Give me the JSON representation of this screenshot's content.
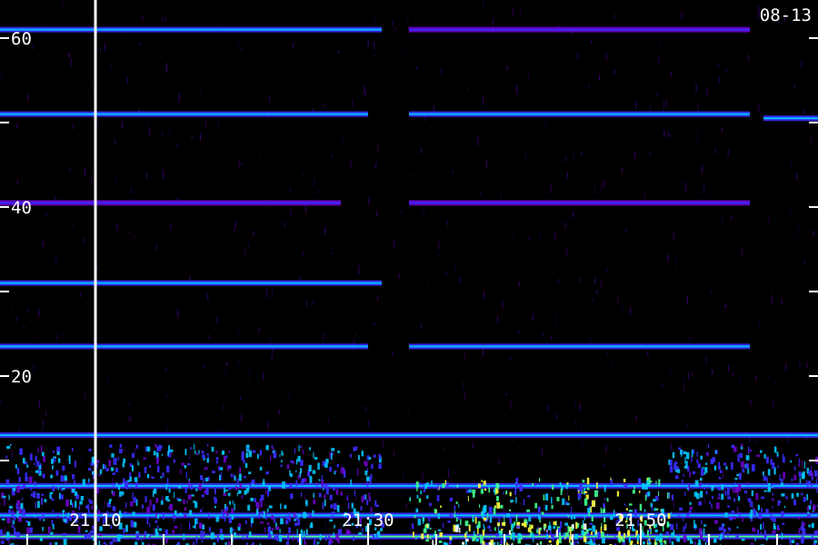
{
  "chart_data": {
    "type": "heatmap",
    "title": "",
    "date_label": "08-13",
    "xlabel": "",
    "ylabel": "",
    "ylim": [
      0,
      64.5
    ],
    "y_ticks": [
      {
        "value": 60,
        "label": "60"
      },
      {
        "value": 50,
        "label": ""
      },
      {
        "value": 40,
        "label": "40"
      },
      {
        "value": 30,
        "label": ""
      },
      {
        "value": 20,
        "label": "20"
      },
      {
        "value": 10,
        "label": ""
      }
    ],
    "x_range": [
      "21:03",
      "21:63"
    ],
    "x_ticks": [
      {
        "value": "21:10",
        "label": "21:10"
      },
      {
        "value": "21:30",
        "label": "21:30"
      },
      {
        "value": "21:50",
        "label": "21:50"
      }
    ],
    "grid": false,
    "colormap": [
      "#000000",
      "#6a00c8",
      "#3a2cff",
      "#00c8ff",
      "#40ff90",
      "#ffff40",
      "#ffffff"
    ],
    "marker_time": "21:10",
    "features": [
      {
        "kind": "carrier",
        "freq": 61,
        "t_start": "21:03",
        "t_end": "21:31",
        "level": 0.45
      },
      {
        "kind": "carrier",
        "freq": 61,
        "t_start": "21:33",
        "t_end": "21:58",
        "level": 0.35
      },
      {
        "kind": "carrier",
        "freq": 51,
        "t_start": "21:03",
        "t_end": "21:30",
        "level": 0.45
      },
      {
        "kind": "carrier",
        "freq": 51,
        "t_start": "21:33",
        "t_end": "21:58",
        "level": 0.45
      },
      {
        "kind": "carrier",
        "freq": 50.5,
        "t_start": "21:59",
        "t_end": "21:63",
        "level": 0.55
      },
      {
        "kind": "carrier",
        "freq": 40.5,
        "t_start": "21:03",
        "t_end": "21:28",
        "level": 0.3
      },
      {
        "kind": "carrier",
        "freq": 40.5,
        "t_start": "21:33",
        "t_end": "21:58",
        "level": 0.4
      },
      {
        "kind": "carrier",
        "freq": 31,
        "t_start": "21:03",
        "t_end": "21:31",
        "level": 0.5
      },
      {
        "kind": "carrier",
        "freq": 23.5,
        "t_start": "21:03",
        "t_end": "21:30",
        "level": 0.45
      },
      {
        "kind": "carrier",
        "freq": 23.5,
        "t_start": "21:33",
        "t_end": "21:58",
        "level": 0.55
      },
      {
        "kind": "carrier",
        "freq": 13,
        "t_start": "21:03",
        "t_end": "21:63",
        "level": 0.45
      },
      {
        "kind": "carrier",
        "freq": 7,
        "t_start": "21:03",
        "t_end": "21:63",
        "level": 0.5
      },
      {
        "kind": "carrier",
        "freq": 3.5,
        "t_start": "21:03",
        "t_end": "21:63",
        "level": 0.55
      },
      {
        "kind": "carrier",
        "freq": 1,
        "t_start": "21:03",
        "t_end": "21:63",
        "level": 0.6
      },
      {
        "kind": "noise",
        "freq_lo": 0,
        "freq_hi": 8,
        "t_start": "21:33",
        "t_end": "21:52",
        "level": 0.85
      },
      {
        "kind": "noise",
        "freq_lo": 0,
        "freq_hi": 12,
        "t_start": "21:03",
        "t_end": "21:31",
        "level": 0.55
      },
      {
        "kind": "noise",
        "freq_lo": 0,
        "freq_hi": 12,
        "t_start": "21:52",
        "t_end": "21:63",
        "level": 0.55
      },
      {
        "kind": "noise",
        "freq_lo": 0,
        "freq_hi": 3,
        "t_start": "21:34",
        "t_end": "21:52",
        "level": 1.0
      }
    ]
  }
}
